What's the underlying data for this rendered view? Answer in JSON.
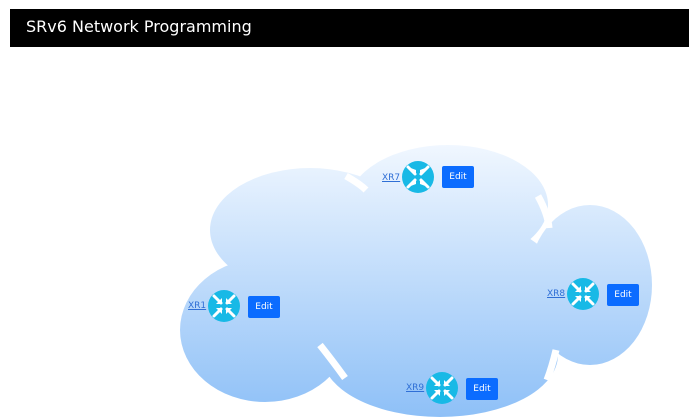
{
  "app": {
    "title": "SRv6 Network Programming"
  },
  "colors": {
    "title_bar": "#000000",
    "cloud_top": "#f2f8ff",
    "cloud_bottom": "#8ec0f7",
    "router": "#18b9e6",
    "edit_button": "#0b6cff",
    "link_text": "#2f6fd6"
  },
  "nodes": [
    {
      "id": "xr7",
      "label": "XR7",
      "icon": "router-icon",
      "edit_label": "Edit"
    },
    {
      "id": "xr1",
      "label": "XR1",
      "icon": "router-icon",
      "edit_label": "Edit"
    },
    {
      "id": "xr8",
      "label": "XR8",
      "icon": "router-icon",
      "edit_label": "Edit"
    },
    {
      "id": "xr9",
      "label": "XR9",
      "icon": "router-icon",
      "edit_label": "Edit"
    }
  ]
}
